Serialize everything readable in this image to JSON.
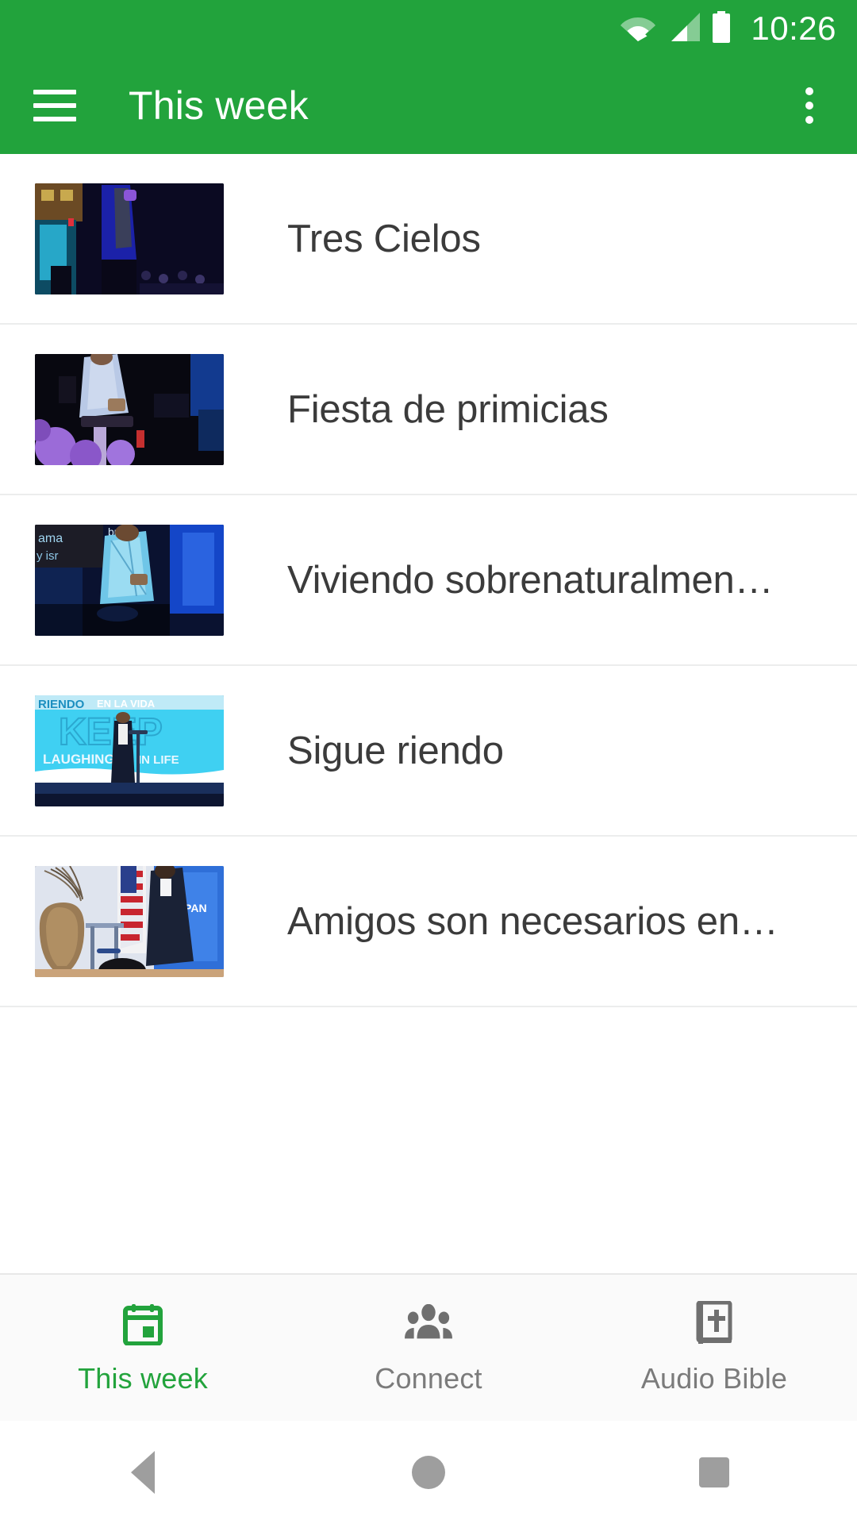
{
  "status_bar": {
    "time": "10:26",
    "icons": [
      "wifi-icon",
      "cellular-signal-icon",
      "battery-icon"
    ]
  },
  "app_bar": {
    "menu_icon": "hamburger-menu-icon",
    "title": "This week",
    "overflow_icon": "more-options-icon",
    "background_color": "#22a33c"
  },
  "list": {
    "items": [
      {
        "title": "Tres Cielos",
        "thumbnail": "speaker-on-dark-blue-stage"
      },
      {
        "title": "Fiesta de primicias",
        "thumbnail": "speaker-at-podium-purple-flowers"
      },
      {
        "title": "Viviendo sobrenaturalmen…",
        "thumbnail": "speaker-in-plaid-jacket-blue-screen"
      },
      {
        "title": "Sigue riendo",
        "thumbnail": "speaker-on-cyan-keep-laughing-stage"
      },
      {
        "title": "Amigos son necesarios en…",
        "thumbnail": "speaker-with-flag-and-vase"
      }
    ]
  },
  "bottom_nav": {
    "active_color": "#22a33c",
    "inactive_color": "#7b7b7b",
    "tabs": [
      {
        "label": "This week",
        "icon": "calendar-icon",
        "active": true
      },
      {
        "label": "Connect",
        "icon": "people-icon",
        "active": false
      },
      {
        "label": "Audio Bible",
        "icon": "bible-cross-icon",
        "active": false
      }
    ]
  },
  "system_nav": {
    "buttons": [
      {
        "name": "back-button",
        "icon": "triangle-back-icon"
      },
      {
        "name": "home-button",
        "icon": "circle-home-icon"
      },
      {
        "name": "recents-button",
        "icon": "square-recents-icon"
      }
    ]
  }
}
